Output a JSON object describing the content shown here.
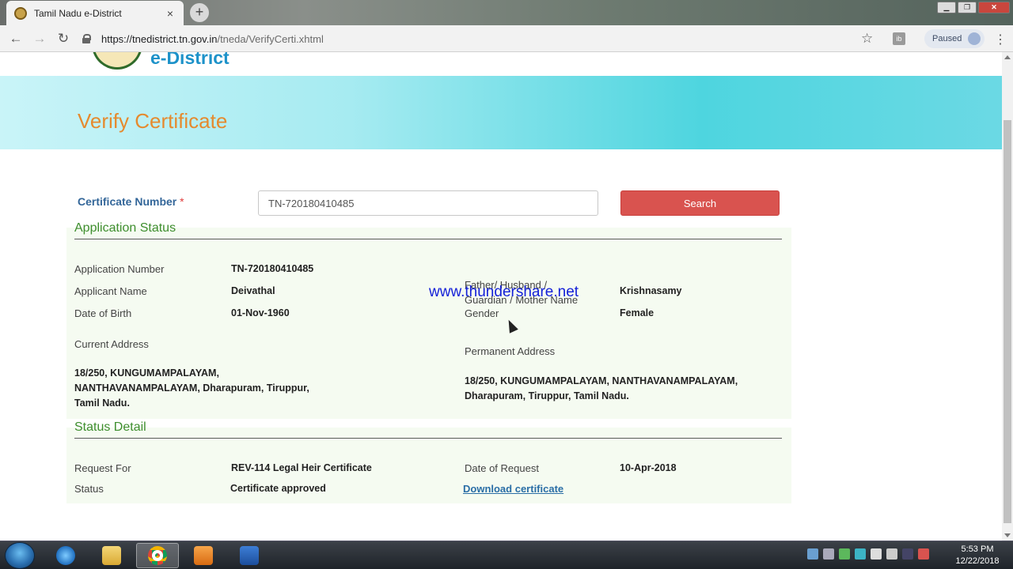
{
  "browser": {
    "tab_title": "Tamil Nadu e-District",
    "tab_close": "×",
    "new_tab": "+",
    "url_host": "https://tnedistrict.tn.gov.in",
    "url_path": "/tneda/VerifyCerti.xhtml",
    "profile_label": "Paused",
    "window_min": "▁",
    "window_restore": "❐",
    "window_close": "✕"
  },
  "site": {
    "brand": "e-District"
  },
  "banner": {
    "title": "Verify Certificate"
  },
  "search": {
    "label": "Certificate Number",
    "required_mark": "*",
    "value": "TN-720180410485",
    "button": "Search"
  },
  "application_status": {
    "heading": "Application Status",
    "application_number_label": "Application Number",
    "application_number": "TN-720180410485",
    "applicant_name_label": "Applicant Name",
    "applicant_name": "Deivathal",
    "dob_label": "Date of Birth",
    "dob": "01-Nov-1960",
    "guardian_label_line1": "Father/ Husband /",
    "guardian_label_line2": "Guardian / Mother Name",
    "guardian_name": "Krishnasamy",
    "gender_label": "Gender",
    "gender": "Female",
    "current_address_label": "Current Address",
    "current_address_line1": "18/250, KUNGUMAMPALAYAM,",
    "current_address_line2": "NANTHAVANAMPALAYAM, Dharapuram, Tiruppur,",
    "current_address_line3": "Tamil Nadu.",
    "permanent_address_label": "Permanent Address",
    "permanent_address_line1": "18/250, KUNGUMAMPALAYAM, NANTHAVANAMPALAYAM,",
    "permanent_address_line2": "Dharapuram, Tiruppur, Tamil Nadu."
  },
  "status_detail": {
    "heading": "Status Detail",
    "request_for_label": "Request For",
    "request_for": "REV-114 Legal Heir Certificate",
    "date_of_request_label": "Date of Request",
    "date_of_request": "10-Apr-2018",
    "status_label": "Status",
    "status": "Certificate approved",
    "download_link": "Download certificate"
  },
  "watermark": "www.thundershare.net",
  "taskbar": {
    "time": "5:53 PM",
    "date": "12/22/2018"
  }
}
